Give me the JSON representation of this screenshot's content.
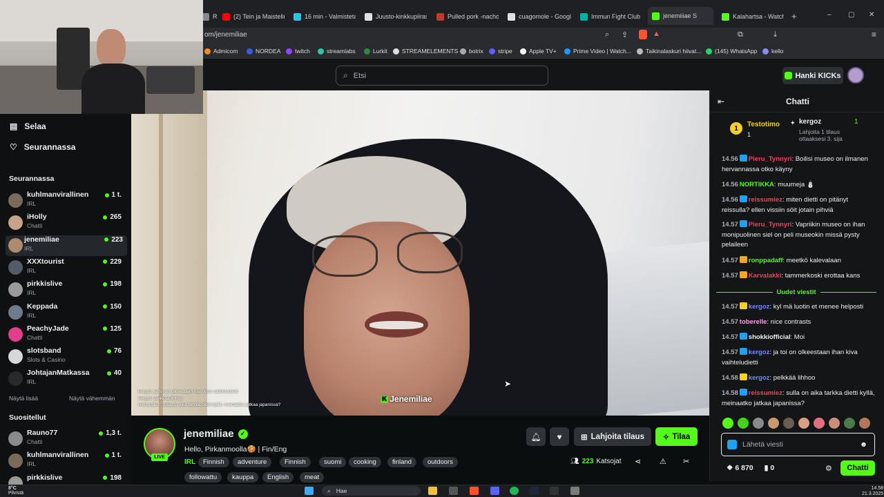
{
  "browser": {
    "tabs": [
      {
        "label": "Re",
        "color": "#888"
      },
      {
        "label": "(2) Tein ja Maistelin",
        "color": "#ff0000"
      },
      {
        "label": "16 min - Valmistetaa",
        "color": "#27c5e0"
      },
      {
        "label": "Juusto-kinkkupiiras",
        "color": "#e0e0e0"
      },
      {
        "label": "Pulled pork -nachot",
        "color": "#c0392b"
      },
      {
        "label": "cuagomole - Google",
        "color": "#e0e0e0"
      },
      {
        "label": "Immun Fight Club |",
        "color": "#00b3a0"
      },
      {
        "label": "jenemiiiae S",
        "color": "#53fc18"
      },
      {
        "label": "Kalahartsa - Watch",
        "color": "#53fc18"
      }
    ],
    "new_tab_icon": "+",
    "url": "om/jenemiliae",
    "bookmarks": [
      {
        "label": "Admicom",
        "color": "#f08a24"
      },
      {
        "label": "NORDEA",
        "color": "#3b5bdb"
      },
      {
        "label": "twitch",
        "color": "#9146ff"
      },
      {
        "label": "streamlabs",
        "color": "#31c3a2"
      },
      {
        "label": "Lurkit",
        "color": "#2b8a3e"
      },
      {
        "label": "STREAMELEMENTS",
        "color": "#dddddd"
      },
      {
        "label": "botrix",
        "color": "#aaaaaa"
      },
      {
        "label": "stripe",
        "color": "#635bff"
      },
      {
        "label": "Apple TV+",
        "color": "#ffffff"
      },
      {
        "label": "Prime Video | Watch...",
        "color": "#1a98ff"
      },
      {
        "label": "Taikinalaskuri hiivat...",
        "color": "#bbbbbb"
      },
      {
        "label": "(145) WhatsApp",
        "color": "#25d366"
      },
      {
        "label": "kello",
        "color": "#8888ff"
      }
    ]
  },
  "kick": {
    "search_placeholder": "Etsi",
    "hanki_label": "Hanki KICKs"
  },
  "sidebar": {
    "nav": [
      {
        "label": "Selaa",
        "icon": "browse-icon"
      },
      {
        "label": "Seurannassa",
        "icon": "heart-icon"
      }
    ],
    "following_header": "Seurannassa",
    "following": [
      {
        "name": "kuhlmanvirallinen",
        "category": "IRL",
        "viewers": "1 t.",
        "color": "#7a6a5a"
      },
      {
        "name": "iHolly",
        "category": "Chatti",
        "viewers": "265",
        "color": "#c7a38c"
      },
      {
        "name": "jenemiliae",
        "category": "IRL",
        "viewers": "223",
        "color": "#b08a6f"
      },
      {
        "name": "XXXtourist",
        "category": "IRL",
        "viewers": "229",
        "color": "#555b66"
      },
      {
        "name": "pirkkislive",
        "category": "IRL",
        "viewers": "198",
        "color": "#9a9a9a"
      },
      {
        "name": "Keppada",
        "category": "IRL",
        "viewers": "150",
        "color": "#6d7c8c"
      },
      {
        "name": "PeachyJade",
        "category": "Chatti",
        "viewers": "125",
        "color": "#e0408a"
      },
      {
        "name": "slotsband",
        "category": "Slots & Casino",
        "viewers": "76",
        "color": "#d8d8d8"
      },
      {
        "name": "JohtajanMatkassa",
        "category": "IRL",
        "viewers": "40",
        "color": "#2a2a2a"
      }
    ],
    "show_more": "Näytä lisää",
    "show_less": "Näytä vähemmän",
    "recommended_header": "Suositellut",
    "recommended": [
      {
        "name": "Rauno77",
        "category": "Chatti",
        "viewers": "1,3 t.",
        "color": "#8a8a8a"
      },
      {
        "name": "kuhlmanvirallinen",
        "category": "IRL",
        "viewers": "1 t.",
        "color": "#7a6a5a"
      },
      {
        "name": "pirkkislive",
        "category": "IRL",
        "viewers": "198",
        "color": "#9a9a9a"
      }
    ]
  },
  "video": {
    "watermark": "Jenemiliae",
    "overlay_lines": [
      "kergoz: ja toi on olkeestaan ihan kiva vaihteludietti",
      "kergoz: pelkkää lihhoo",
      "reissumiez: sulla on aika tarkka dietti kyllä, meinaatko jatkaa japanissa?"
    ]
  },
  "stream": {
    "channel": "jenemiliae",
    "live_badge": "LIVE",
    "title": "Hello, Pirkanmoolla🍪 | Fin/Eng",
    "category": "IRL",
    "tags_row1": [
      "Finnish",
      "adventure",
      "Finnish",
      "suomi",
      "cooking",
      "finland",
      "outdoors"
    ],
    "tags_row2": [
      "followattu",
      "kauppa",
      "English",
      "meat"
    ],
    "gift_label": "Lahjoita tilaus",
    "subscribe_label": "Tilaa",
    "viewers_count": "223",
    "viewers_label": "Katsojat"
  },
  "chat": {
    "title": "Chatti",
    "pinned": {
      "rank": "1",
      "user": "Testotimo",
      "count": "1",
      "gifter": "kergoz",
      "gifter_count": "1",
      "line1": "Lahjoita 1 tilaus",
      "line2": "ottaaksesi 3. sija"
    },
    "messages": [
      {
        "time": "14.56",
        "user": "Pieru_Tynnyri",
        "color": "#ff3b5c",
        "badge": "#1da1f2",
        "text": "Boilisi museo on ilmanen hervannassa otko käyny"
      },
      {
        "time": "14.56",
        "user": "NORTIKKA",
        "color": "#53fc18",
        "badge": "",
        "text": "muumeja ⛄"
      },
      {
        "time": "14.56",
        "user": "reissumiez",
        "color": "#ff3b5c",
        "badge": "#1da1f2",
        "text": "miten dietti on pitänyt reissulla? ellen vissiin söit jotain pihviä"
      },
      {
        "time": "14.57",
        "user": "Pieru_Tynnyri",
        "color": "#ff3b5c",
        "badge": "#1da1f2",
        "text": "Vapriikin museo on ihan monipuolinen siel on peli museokin missä pysty pelaileen"
      },
      {
        "time": "14.57",
        "user": "ronppadaff",
        "color": "#53fc18",
        "badge": "#f5a623",
        "text": "meetkö kalevalaan"
      },
      {
        "time": "14.57",
        "user": "Karvalakki",
        "color": "#ff3b5c",
        "badge": "#f5a623",
        "text": "tammerkoski erottaa kans"
      }
    ],
    "new_messages_label": "Uudet viestit",
    "new_messages": [
      {
        "time": "14.57",
        "user": "kergoz",
        "color": "#6f8cff",
        "badge": "#f5d023",
        "text": "kyl mä luotin et menee helposti"
      },
      {
        "time": "14.57",
        "user": "toberelle",
        "color": "#ff9ff0",
        "badge": "",
        "text": "nice contrasts"
      },
      {
        "time": "14.57",
        "user": "shokkiofficial",
        "color": "#efeff1",
        "badge": "#1da1f2",
        "text": "Moi"
      },
      {
        "time": "14.57",
        "user": "kergoz",
        "color": "#6f8cff",
        "badge": "#1da1f2",
        "text": "ja toi on olkeestaan ihan kiva vaihteludietti"
      },
      {
        "time": "14.58",
        "user": "kergoz",
        "color": "#6f8cff",
        "badge": "#f5d023",
        "text": "pelkkää lihhoo"
      },
      {
        "time": "14.58",
        "user": "reissumiez",
        "color": "#ff3b5c",
        "badge": "#1da1f2",
        "text": "sulla on aika tarkka dietti kyllä, meinaatko jatkaa japanissa?"
      }
    ],
    "input_placeholder": "Lähetä viesti",
    "points": "6 870",
    "kicks": "0",
    "send_label": "Chatti"
  },
  "taskbar": {
    "search_placeholder": "Hae",
    "temp": "8°C",
    "weather": "Pilvistä",
    "time": "14.58",
    "date": "21.3.2025"
  }
}
